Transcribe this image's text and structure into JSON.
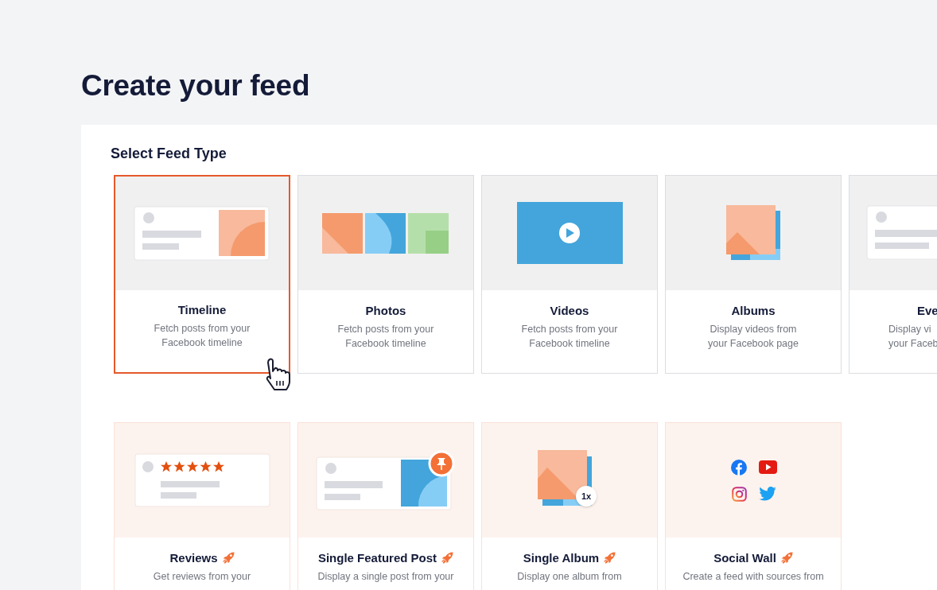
{
  "page_title": "Create your feed",
  "section_title": "Select Feed Type",
  "rows": [
    {
      "cards": [
        {
          "kind": "timeline",
          "title": "Timeline",
          "description": [
            "Fetch posts from your",
            "Facebook timeline"
          ],
          "selected": true,
          "pro": false,
          "pointer": true
        },
        {
          "kind": "photos",
          "title": "Photos",
          "description": [
            "Fetch posts from your",
            "Facebook timeline"
          ],
          "selected": false,
          "pro": false,
          "pointer": false
        },
        {
          "kind": "videos",
          "title": "Videos",
          "description": [
            "Fetch posts from your",
            "Facebook timeline"
          ],
          "selected": false,
          "pro": false,
          "pointer": false
        },
        {
          "kind": "albums",
          "title": "Albums",
          "description": [
            "Display videos from",
            "your Facebook page"
          ],
          "selected": false,
          "pro": false,
          "pointer": false
        },
        {
          "kind": "events",
          "title": "Eve",
          "description": [
            "Display vi",
            "your Faceb"
          ],
          "selected": false,
          "pro": false,
          "pointer": false
        }
      ]
    },
    {
      "cards": [
        {
          "kind": "reviews",
          "title": "Reviews",
          "description": [
            "Get reviews from your"
          ],
          "selected": false,
          "pro": true,
          "pointer": false
        },
        {
          "kind": "featured",
          "title": "Single Featured Post",
          "description": [
            "Display a single post from your"
          ],
          "selected": false,
          "pro": true,
          "pointer": false
        },
        {
          "kind": "single-album",
          "title": "Single Album",
          "badge": "1x",
          "description": [
            "Display one album from"
          ],
          "selected": false,
          "pro": true,
          "pointer": false
        },
        {
          "kind": "social-wall",
          "title": "Social Wall",
          "description": [
            "Create a feed with sources from"
          ],
          "selected": false,
          "pro": true,
          "pointer": false
        }
      ]
    }
  ]
}
